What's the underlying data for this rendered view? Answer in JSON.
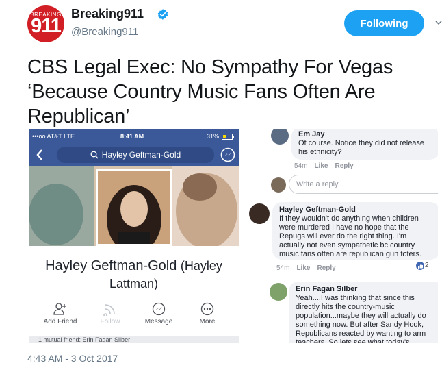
{
  "tweet": {
    "author_name": "Breaking911",
    "handle": "@Breaking911",
    "avatar_text_small": "BREAKING",
    "avatar_text_big": "911",
    "follow_label": "Following",
    "headline": "CBS Legal Exec: No Sympathy For Vegas ‘Because Country Music Fans Often Are Republican’",
    "timestamp": "4:43 AM - 3 Oct 2017",
    "colors": {
      "follow_button": "#1da1f2",
      "avatar_bg": "#d21f26",
      "verified": "#1da1f2"
    }
  },
  "phone": {
    "statusbar": {
      "carrier": "•••oo AT&T  LTE",
      "time": "8:41 AM",
      "battery": "31%"
    },
    "search_value": "Hayley Geftman-Gold",
    "profile_name": "Hayley Geftman-Gold",
    "profile_alt_name": "(Hayley Lattman)",
    "actions": [
      {
        "label": "Add Friend",
        "icon": "add-friend-icon"
      },
      {
        "label": "Follow",
        "icon": "follow-icon"
      },
      {
        "label": "Message",
        "icon": "messenger-icon"
      },
      {
        "label": "More",
        "icon": "more-icon"
      }
    ],
    "mutual_text": "1 mutual friend: Erin Fagan Silber",
    "colors": {
      "facebook_blue": "#3b5998"
    }
  },
  "comments": [
    {
      "author": "Em Jay",
      "text": "Of course. Notice they did not release his ethnicity?",
      "age": "54m",
      "like": "Like",
      "reply": "Reply"
    },
    {
      "author": "Hayley Geftman-Gold",
      "text": "If they wouldn't do anything when children were murdered I have no hope that the Repugs will ever do the right thing. I'm actually not even sympathetic bc country music fans often are republican gun toters.",
      "age": "54m",
      "like": "Like",
      "reply": "Reply",
      "reactions": "2"
    },
    {
      "author": "Erin Fagan Silber",
      "text": "Yeah....I was thinking that since this directly hits the country-music population...maybe they will actually do something now. But after Sandy Hook, Republicans reacted by wanting to arm teachers. So lets see what today's"
    }
  ],
  "reply_placeholder": "Write a reply..."
}
